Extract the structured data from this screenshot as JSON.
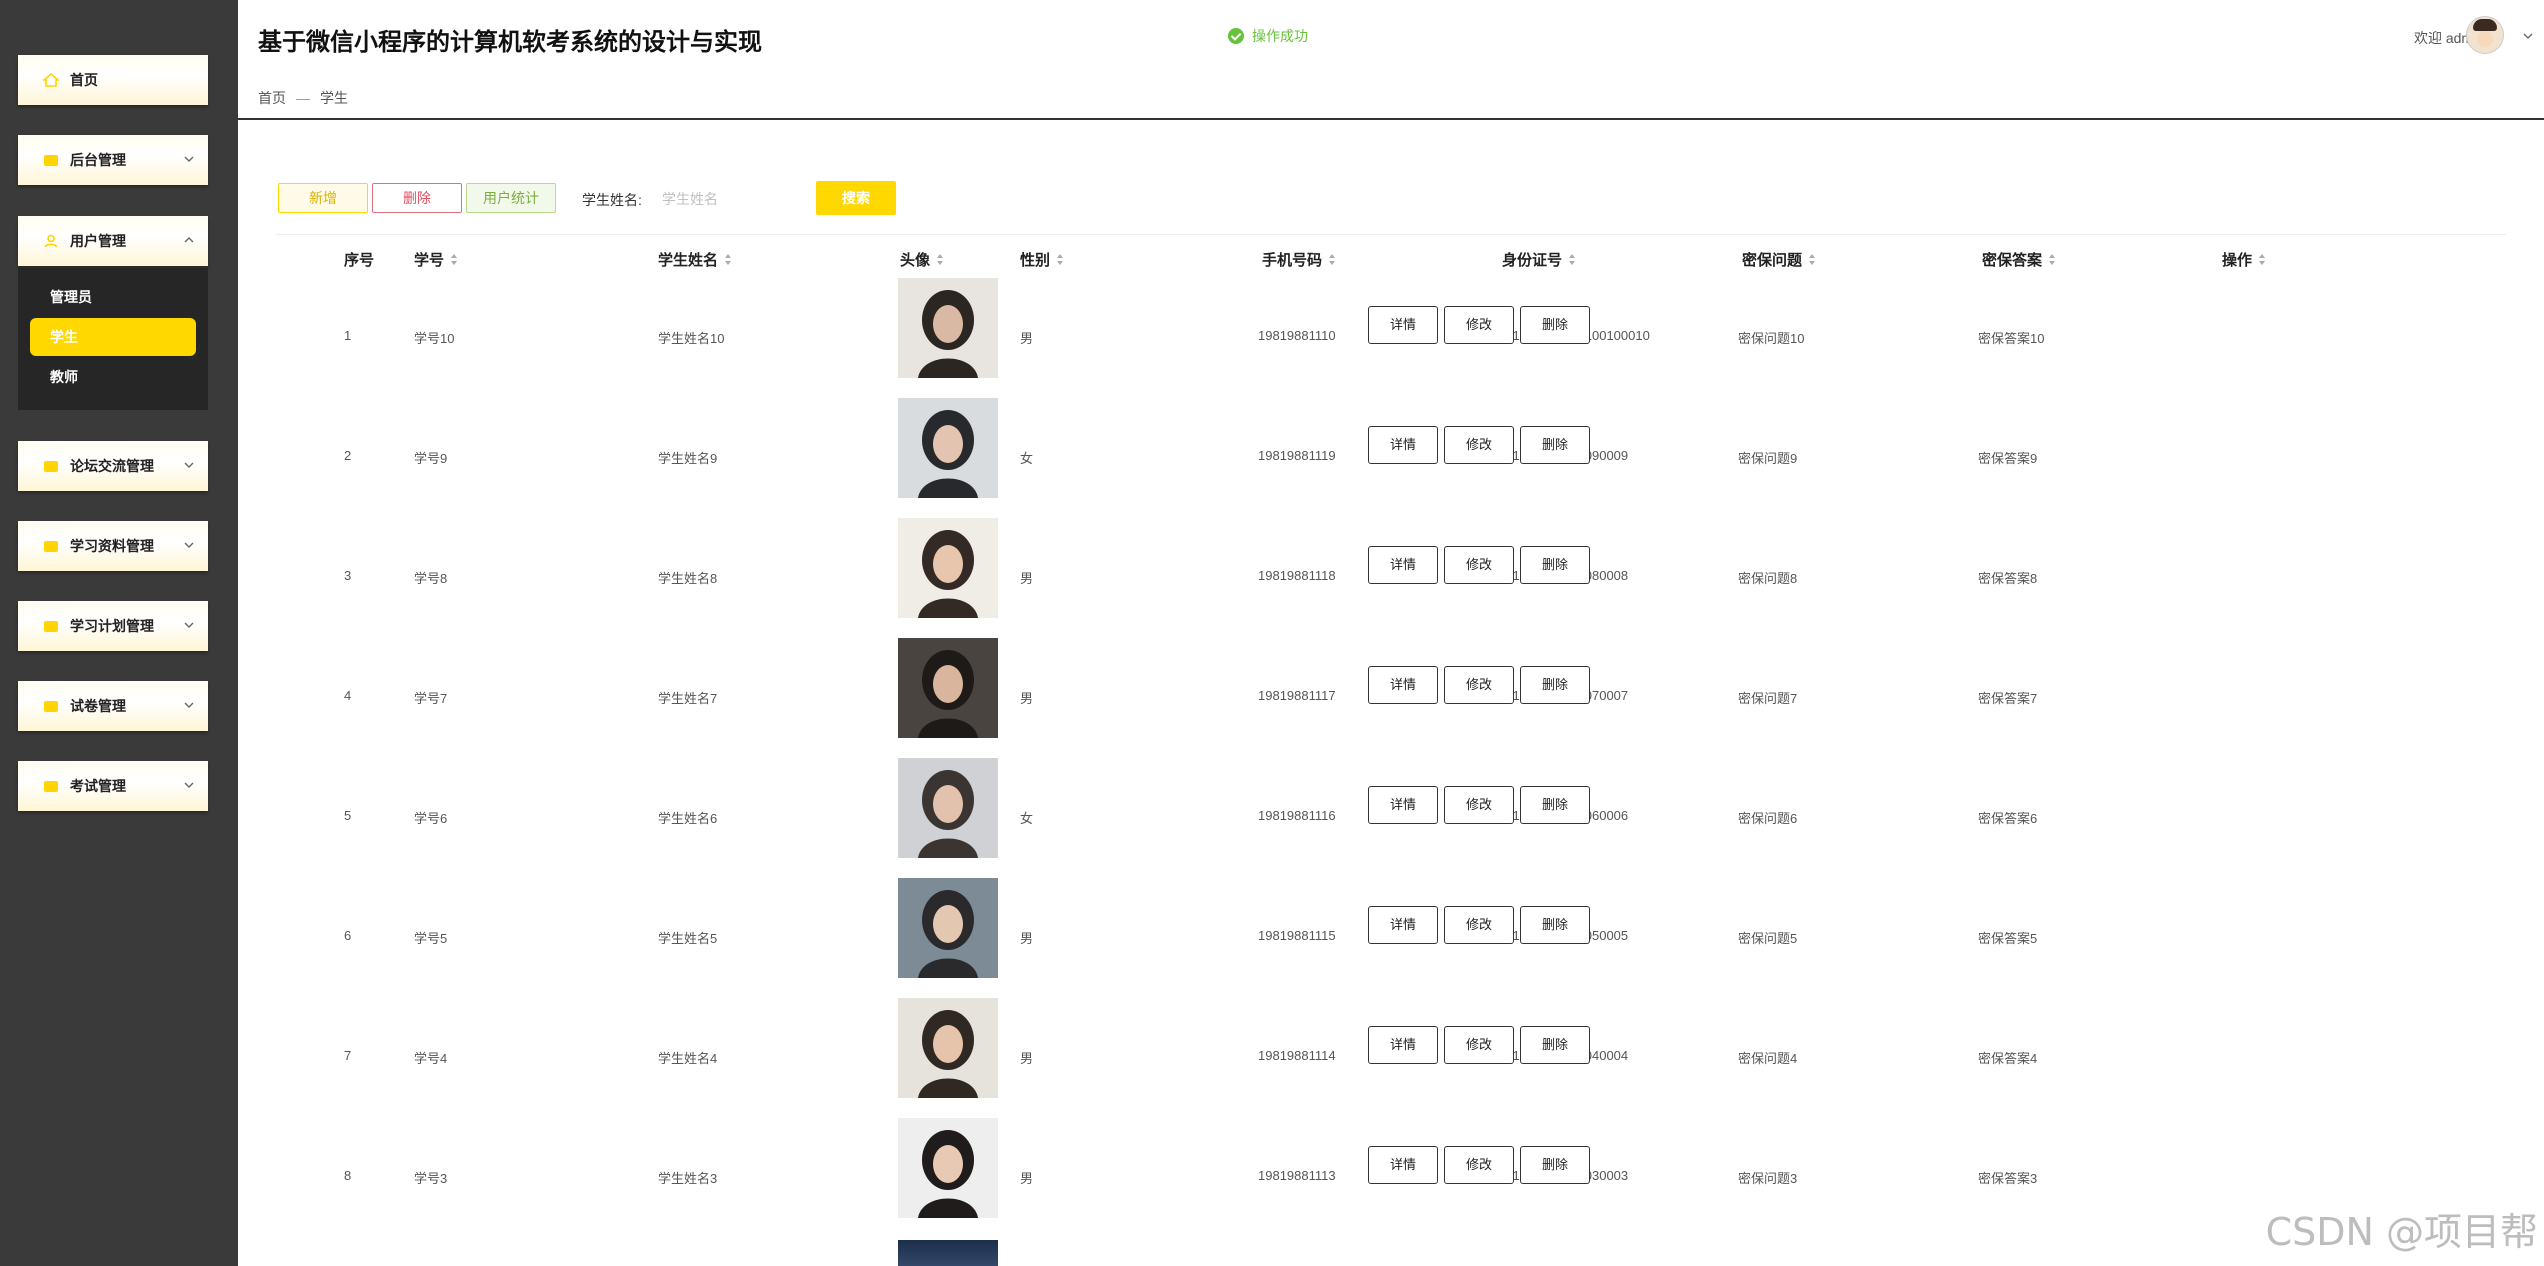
{
  "header": {
    "title": "基于微信小程序的计算机软考系统的设计与实现",
    "toast": "操作成功",
    "welcome": "欢迎 admin",
    "breadcrumb": [
      "首页",
      "—",
      "学生"
    ]
  },
  "sidebar": {
    "items": [
      {
        "label": "首页"
      },
      {
        "label": "后台管理"
      },
      {
        "label": "用户管理"
      },
      {
        "label": "论坛交流管理"
      },
      {
        "label": "学习资料管理"
      },
      {
        "label": "学习计划管理"
      },
      {
        "label": "试卷管理"
      },
      {
        "label": "考试管理"
      }
    ],
    "submenu": [
      {
        "label": "管理员"
      },
      {
        "label": "学生"
      },
      {
        "label": "教师"
      }
    ]
  },
  "toolbar": {
    "add_label": "新增",
    "delete_label": "删除",
    "stats_label": "用户统计",
    "search_label": "学生姓名:",
    "search_placeholder": "学生姓名",
    "search_button": "搜索"
  },
  "table": {
    "headers": [
      "序号",
      "学号",
      "学生姓名",
      "头像",
      "性别",
      "手机号码",
      "身份证号",
      "密保问题",
      "密保答案",
      "操作"
    ],
    "actions": [
      "详情",
      "修改",
      "删除"
    ],
    "rows": [
      {
        "idx": "1",
        "sid": "学号10",
        "name": "学生姓名10",
        "gender": "男",
        "phone": "19819881110",
        "id_no": "441622200100100100010",
        "question": "密保问题10",
        "answer": "密保答案10"
      },
      {
        "idx": "2",
        "sid": "学号9",
        "name": "学生姓名9",
        "gender": "女",
        "phone": "19819881119",
        "id_no": "441622200909090009",
        "question": "密保问题9",
        "answer": "密保答案9"
      },
      {
        "idx": "3",
        "sid": "学号8",
        "name": "学生姓名8",
        "gender": "男",
        "phone": "19819881118",
        "id_no": "441622200808080008",
        "question": "密保问题8",
        "answer": "密保答案8"
      },
      {
        "idx": "4",
        "sid": "学号7",
        "name": "学生姓名7",
        "gender": "男",
        "phone": "19819881117",
        "id_no": "441622200707070007",
        "question": "密保问题7",
        "answer": "密保答案7"
      },
      {
        "idx": "5",
        "sid": "学号6",
        "name": "学生姓名6",
        "gender": "女",
        "phone": "19819881116",
        "id_no": "441622200606060006",
        "question": "密保问题6",
        "answer": "密保答案6"
      },
      {
        "idx": "6",
        "sid": "学号5",
        "name": "学生姓名5",
        "gender": "男",
        "phone": "19819881115",
        "id_no": "441622200505050005",
        "question": "密保问题5",
        "answer": "密保答案5"
      },
      {
        "idx": "7",
        "sid": "学号4",
        "name": "学生姓名4",
        "gender": "男",
        "phone": "19819881114",
        "id_no": "441622200404040004",
        "question": "密保问题4",
        "answer": "密保答案4"
      },
      {
        "idx": "8",
        "sid": "学号3",
        "name": "学生姓名3",
        "gender": "男",
        "phone": "19819881113",
        "id_no": "441622200303030003",
        "question": "密保问题3",
        "answer": "密保答案3"
      }
    ]
  },
  "watermark": "CSDN @项目帮",
  "colors": {
    "accent": "#ffd800",
    "sidebar_bg": "#3a3a3a",
    "success": "#67c23a",
    "danger": "#e05060"
  }
}
